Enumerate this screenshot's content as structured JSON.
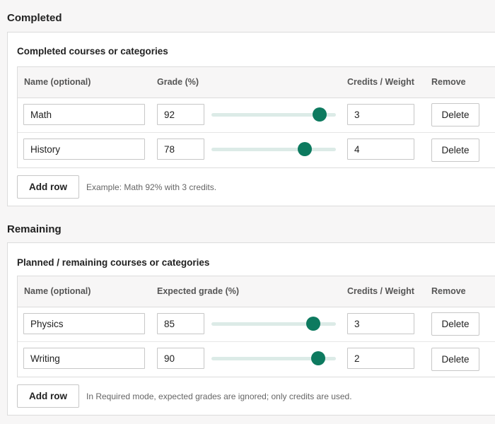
{
  "completed": {
    "section_title": "Completed",
    "heading": "Completed courses or categories",
    "columns": {
      "name": "Name (optional)",
      "grade": "Grade (%)",
      "credits": "Credits / Weight",
      "remove": "Remove"
    },
    "rows": [
      {
        "name": "Math",
        "grade": "92",
        "credits": "3",
        "slider_percent": 87,
        "delete_label": "Delete"
      },
      {
        "name": "History",
        "grade": "78",
        "credits": "4",
        "slider_percent": 75,
        "delete_label": "Delete"
      }
    ],
    "add_row_label": "Add row",
    "hint": "Example: Math 92% with 3 credits."
  },
  "remaining": {
    "section_title": "Remaining",
    "heading": "Planned / remaining courses or categories",
    "columns": {
      "name": "Name (optional)",
      "grade": "Expected grade (%)",
      "credits": "Credits / Weight",
      "remove": "Remove"
    },
    "rows": [
      {
        "name": "Physics",
        "grade": "85",
        "credits": "3",
        "slider_percent": 82,
        "delete_label": "Delete"
      },
      {
        "name": "Writing",
        "grade": "90",
        "credits": "2",
        "slider_percent": 86,
        "delete_label": "Delete"
      }
    ],
    "add_row_label": "Add row",
    "hint": "In Required mode, expected grades are ignored; only credits are used."
  },
  "colors": {
    "accent": "#0d7a5f",
    "track": "#dcebe7"
  }
}
